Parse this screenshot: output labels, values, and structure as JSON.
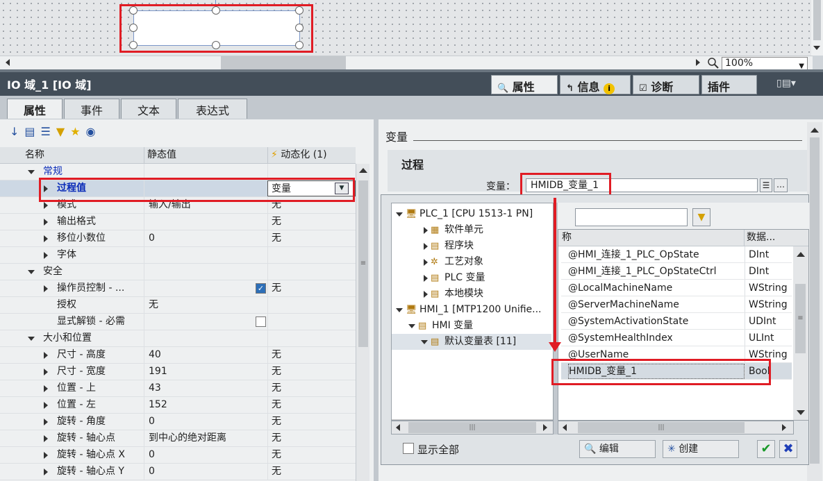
{
  "canvas": {
    "zoom": "100%"
  },
  "header": {
    "title": "IO 域_1 [IO 域]",
    "tabs": [
      "属性",
      "信息",
      "诊断",
      "插件"
    ],
    "info_badge": "i"
  },
  "main_tabs": [
    "属性",
    "事件",
    "文本",
    "表达式"
  ],
  "left": {
    "columns": [
      "名称",
      "静态值",
      "动态化 (1)"
    ],
    "rows": [
      {
        "name": "常规",
        "static": "",
        "dynamic": "",
        "level": 0,
        "expanded": true,
        "blue": true
      },
      {
        "name": "过程值",
        "static": "",
        "dynamic": "变量",
        "level": 1,
        "blue": true,
        "selected": true
      },
      {
        "name": "模式",
        "static": "输入/输出",
        "dynamic": "无",
        "level": 1
      },
      {
        "name": "输出格式",
        "static": "",
        "dynamic": "无",
        "level": 1
      },
      {
        "name": "移位小数位",
        "static": "0",
        "dynamic": "无",
        "level": 1
      },
      {
        "name": "字体",
        "static": "",
        "dynamic": "",
        "level": 1
      },
      {
        "name": "安全",
        "static": "",
        "dynamic": "",
        "level": 0,
        "expanded": true
      },
      {
        "name": "操作员控制 - ...",
        "static": "",
        "dynamic": "无",
        "level": 1,
        "checkbox": "checked"
      },
      {
        "name": "授权",
        "static": "无",
        "dynamic": "",
        "level": 1,
        "noarrow": true
      },
      {
        "name": "显式解锁 - 必需",
        "static": "",
        "dynamic": "",
        "level": 1,
        "noarrow": true,
        "checkbox": "unchecked"
      },
      {
        "name": "大小和位置",
        "static": "",
        "dynamic": "",
        "level": 0,
        "expanded": true
      },
      {
        "name": "尺寸 - 高度",
        "static": "40",
        "dynamic": "无",
        "level": 1
      },
      {
        "name": "尺寸 - 宽度",
        "static": "191",
        "dynamic": "无",
        "level": 1
      },
      {
        "name": "位置 - 上",
        "static": "43",
        "dynamic": "无",
        "level": 1
      },
      {
        "name": "位置 - 左",
        "static": "152",
        "dynamic": "无",
        "level": 1
      },
      {
        "name": "旋转 - 角度",
        "static": "0",
        "dynamic": "无",
        "level": 1
      },
      {
        "name": "旋转 - 轴心点",
        "static": "到中心的绝对距离",
        "dynamic": "无",
        "level": 1
      },
      {
        "name": "旋转 - 轴心点 X",
        "static": "0",
        "dynamic": "无",
        "level": 1
      },
      {
        "name": "旋转 - 轴心点 Y",
        "static": "0",
        "dynamic": "无",
        "level": 1
      }
    ]
  },
  "right": {
    "section": "变量",
    "group": "过程",
    "var_label": "变量：",
    "var_value": "HMIDB_变量_1",
    "tree": [
      {
        "label": "PLC_1 [CPU 1513-1 PN]",
        "level": 0,
        "open": true
      },
      {
        "label": "软件单元",
        "level": 1
      },
      {
        "label": "程序块",
        "level": 1
      },
      {
        "label": "工艺对象",
        "level": 1
      },
      {
        "label": "PLC 变量",
        "level": 1
      },
      {
        "label": "本地模块",
        "level": 1
      },
      {
        "label": "HMI_1 [MTP1200 Unifie...",
        "level": 0,
        "open": true
      },
      {
        "label": "HMI 变量",
        "level": 1,
        "open": true
      },
      {
        "label": "默认变量表 [11]",
        "level": 2,
        "open": true
      }
    ],
    "grid_headers": [
      "称",
      "数据..."
    ],
    "grid_rows": [
      {
        "name": "@HMI_连接_1_PLC_OpState",
        "type": "DInt"
      },
      {
        "name": "@HMI_连接_1_PLC_OpStateCtrl",
        "type": "DInt"
      },
      {
        "name": "@LocalMachineName",
        "type": "WString"
      },
      {
        "name": "@ServerMachineName",
        "type": "WString"
      },
      {
        "name": "@SystemActivationState",
        "type": "UDInt"
      },
      {
        "name": "@SystemHealthIndex",
        "type": "ULInt"
      },
      {
        "name": "@UserName",
        "type": "WString"
      },
      {
        "name": "HMIDB_变量_1",
        "type": "Bool"
      }
    ],
    "show_all": "显示全部",
    "edit": "编辑",
    "create": "创建"
  },
  "colors": {
    "highlight": "#e01c24",
    "blue_text": "#0a2bb8",
    "dark_bar": "#434e59"
  }
}
